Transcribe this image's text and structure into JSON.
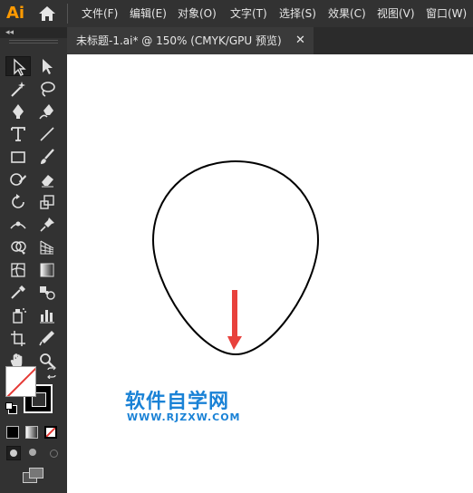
{
  "app": {
    "logo": "Ai"
  },
  "menu": {
    "items": [
      "文件(F)",
      "编辑(E)",
      "对象(O)",
      "文字(T)",
      "选择(S)",
      "效果(C)",
      "视图(V)",
      "窗口(W)"
    ]
  },
  "document_tab": {
    "title": "未标题-1.ai* @ 150% (CMYK/GPU 预览)",
    "close": "✕"
  },
  "toolbar": {
    "collapse": "◂◂",
    "tools": [
      "selection-tool",
      "direct-selection-tool",
      "magic-wand-tool",
      "lasso-tool",
      "pen-tool",
      "curvature-tool",
      "type-tool",
      "line-segment-tool",
      "rectangle-tool",
      "paintbrush-tool",
      "shaper-tool",
      "eraser-tool",
      "rotate-tool",
      "scale-tool",
      "width-tool",
      "puppet-warp-tool",
      "shape-builder-tool",
      "perspective-grid-tool",
      "mesh-tool",
      "gradient-tool",
      "eyedropper-tool",
      "blend-tool",
      "symbol-sprayer-tool",
      "column-graph-tool",
      "artboard-tool",
      "slice-tool",
      "hand-tool",
      "zoom-tool"
    ],
    "fill_stroke": {
      "fill_color": "#ffffff",
      "stroke_color": "#000000"
    }
  },
  "canvas": {
    "background": "#ffffff",
    "watermark": {
      "title": "软件自学网",
      "url": "WWW.RJZXW.COM",
      "color": "#1a82d6"
    },
    "arrow_color": "#e8413c"
  }
}
